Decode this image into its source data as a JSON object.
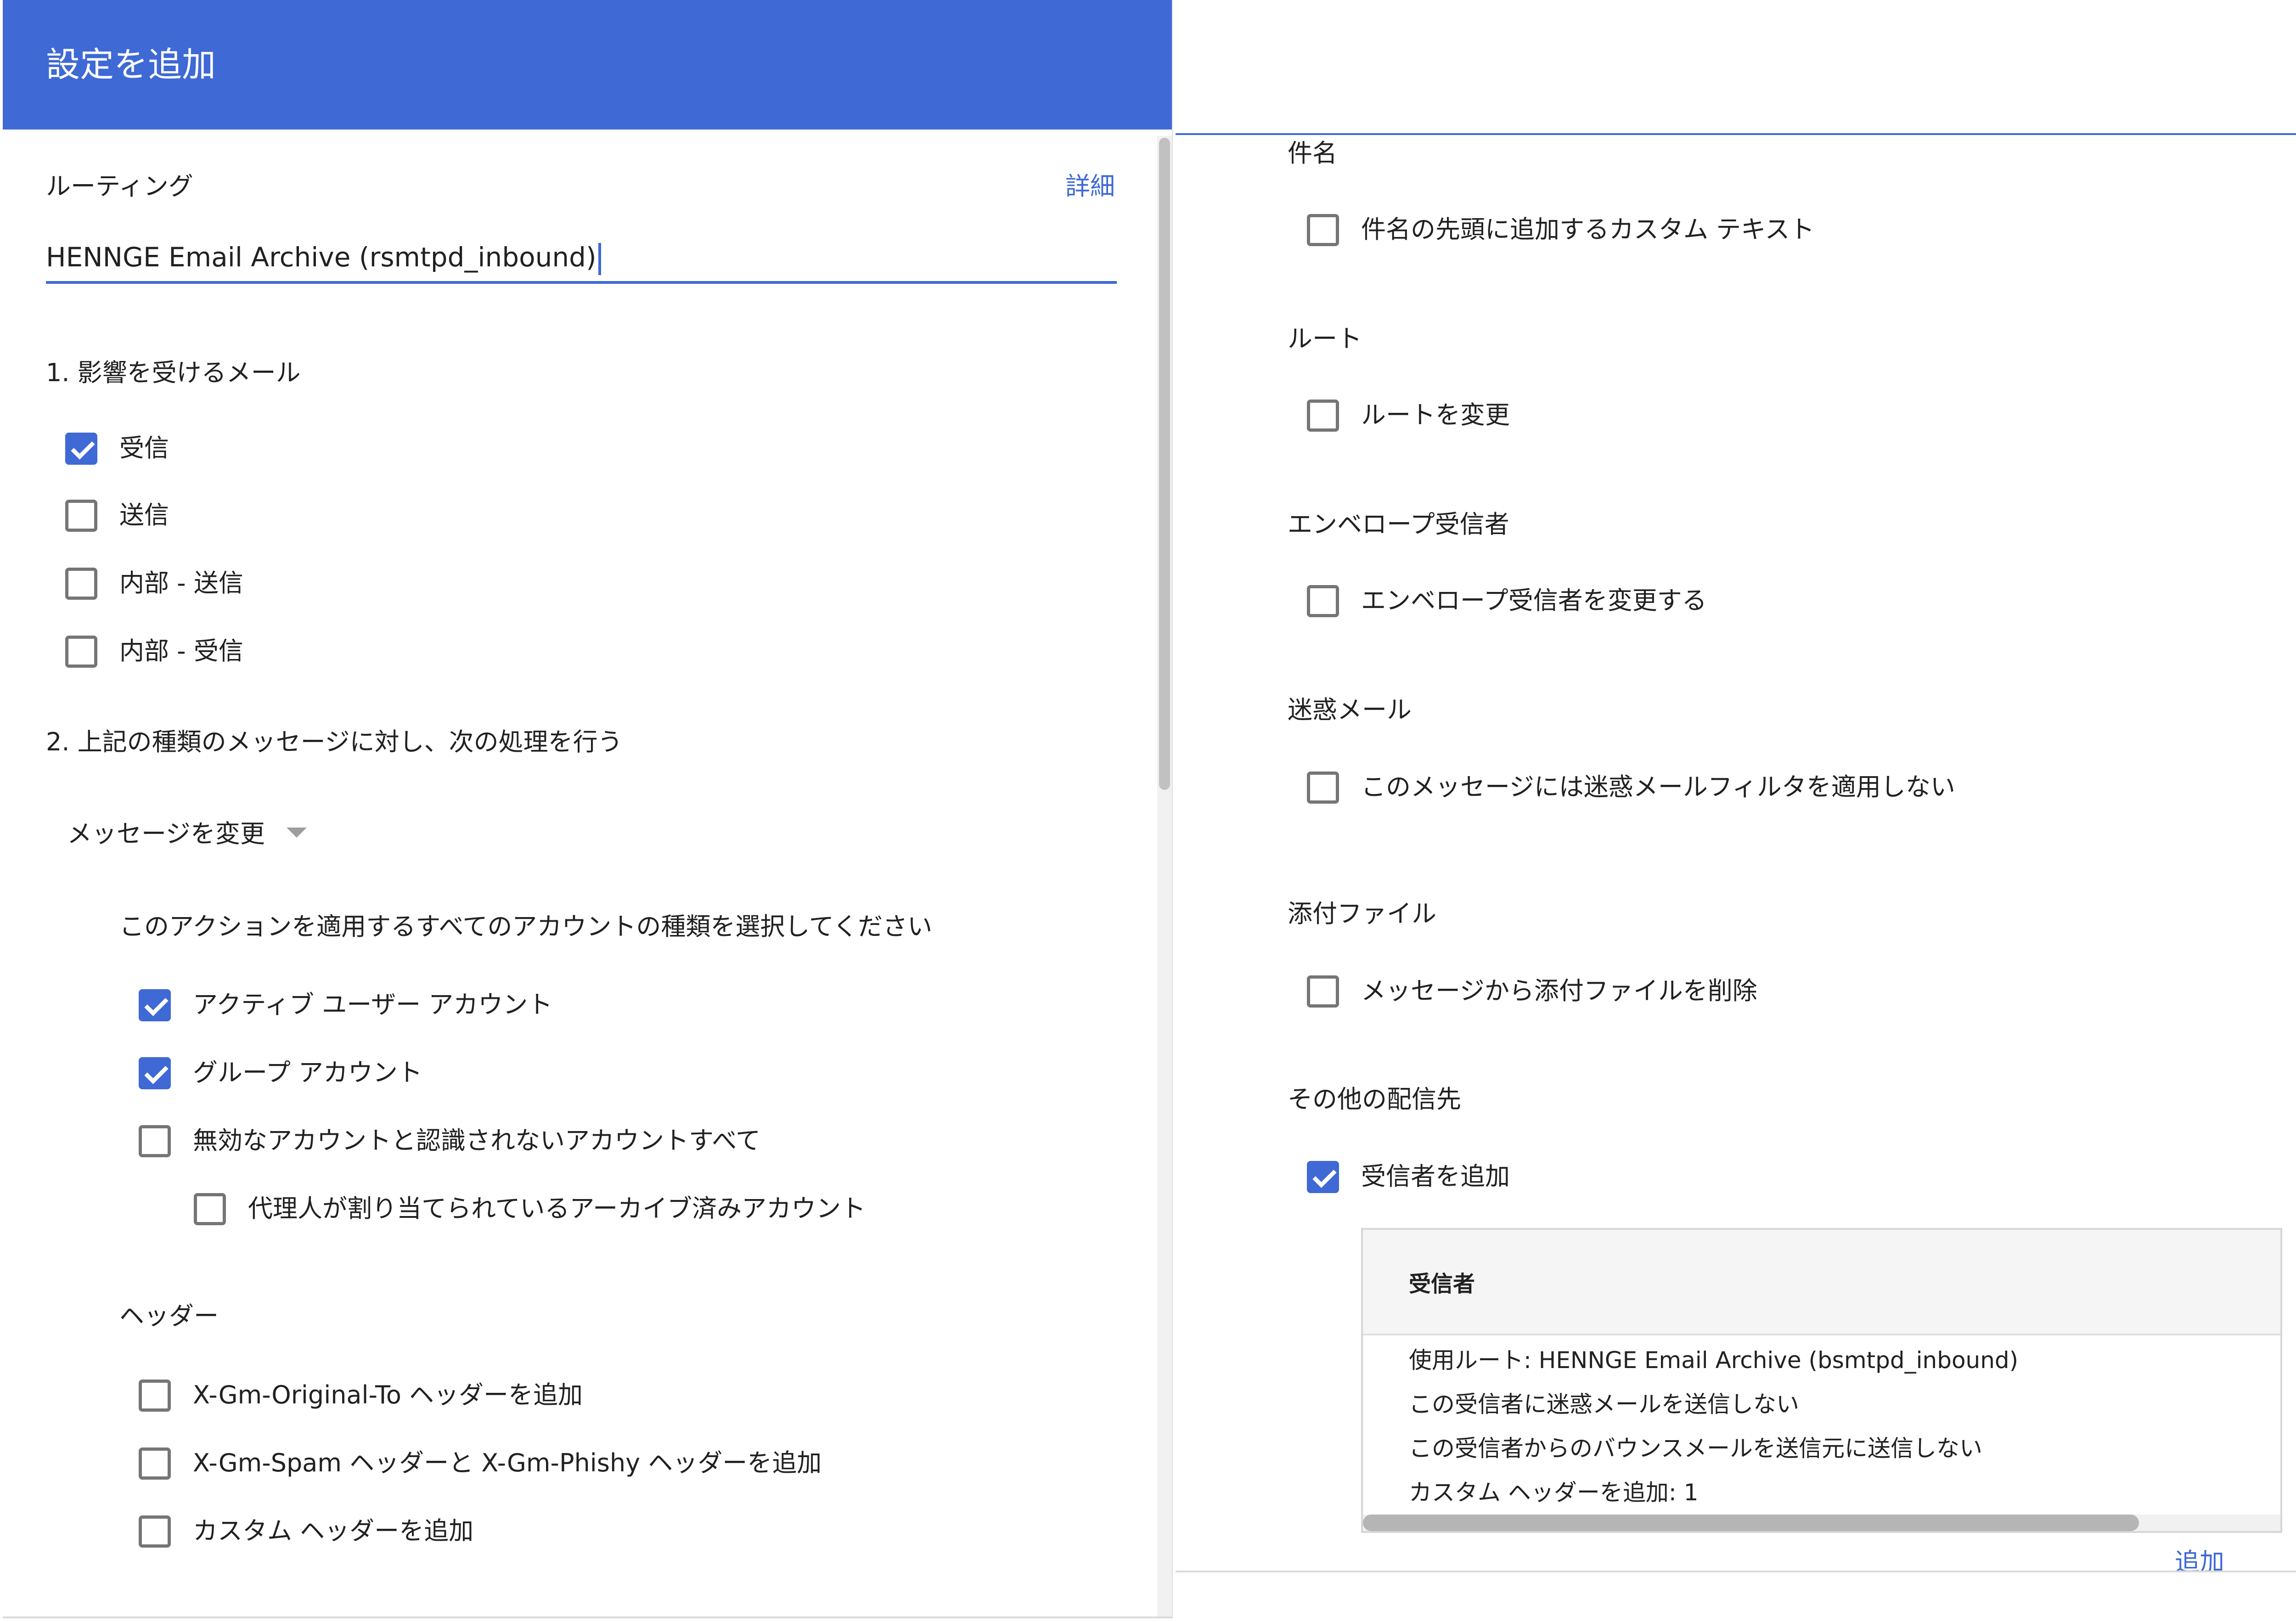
{
  "dialog": {
    "title": "設定を追加",
    "routing_label": "ルーティング",
    "details_link": "詳細",
    "routing_name_value": "HENNGE Email Archive (rsmtpd_inbound)"
  },
  "section1": {
    "heading": "1. 影響を受けるメール",
    "options": [
      {
        "label": "受信",
        "checked": true
      },
      {
        "label": "送信",
        "checked": false
      },
      {
        "label": "内部 - 送信",
        "checked": false
      },
      {
        "label": "内部 - 受信",
        "checked": false
      }
    ]
  },
  "section2": {
    "heading": "2. 上記の種類のメッセージに対し、次の処理を行う",
    "action_dropdown": "メッセージを変更",
    "account_types_prompt": "このアクションを適用するすべてのアカウントの種類を選択してください",
    "account_options": [
      {
        "label": "アクティブ ユーザー アカウント",
        "checked": true
      },
      {
        "label": "グループ アカウント",
        "checked": true
      },
      {
        "label": "無効なアカウントと認識されないアカウントすべて",
        "checked": false
      },
      {
        "label": "代理人が割り当てられているアーカイブ済みアカウント",
        "checked": false
      }
    ],
    "headers_heading": "ヘッダー",
    "header_options": [
      {
        "label": "X-Gm-Original-To ヘッダーを追加",
        "checked": false
      },
      {
        "label": "X-Gm-Spam ヘッダーと X-Gm-Phishy ヘッダーを追加",
        "checked": false
      },
      {
        "label": "カスタム ヘッダーを追加",
        "checked": false
      }
    ]
  },
  "right": {
    "subject_heading": "件名",
    "subject_option": {
      "label": "件名の先頭に追加するカスタム テキスト",
      "checked": false
    },
    "route_heading": "ルート",
    "route_option": {
      "label": "ルートを変更",
      "checked": false
    },
    "envelope_heading": "エンベロープ受信者",
    "envelope_option": {
      "label": "エンベロープ受信者を変更する",
      "checked": false
    },
    "spam_heading": "迷惑メール",
    "spam_option": {
      "label": "このメッセージには迷惑メールフィルタを適用しない",
      "checked": false
    },
    "attachments_heading": "添付ファイル",
    "attachments_option": {
      "label": "メッセージから添付ファイルを削除",
      "checked": false
    },
    "other_delivery_heading": "その他の配信先",
    "other_delivery_option": {
      "label": "受信者を追加",
      "checked": true
    },
    "recipients_table": {
      "header": "受信者",
      "rows": [
        "使用ルート: HENNGE Email Archive (bsmtpd_inbound)",
        "この受信者に迷惑メールを送信しない",
        "この受信者からのバウンスメールを送信元に送信しない",
        "カスタム ヘッダーを追加: 1"
      ]
    },
    "add_link": "追加"
  },
  "colors": {
    "accent": "#3f69d4",
    "checkbox_border": "#757575"
  }
}
